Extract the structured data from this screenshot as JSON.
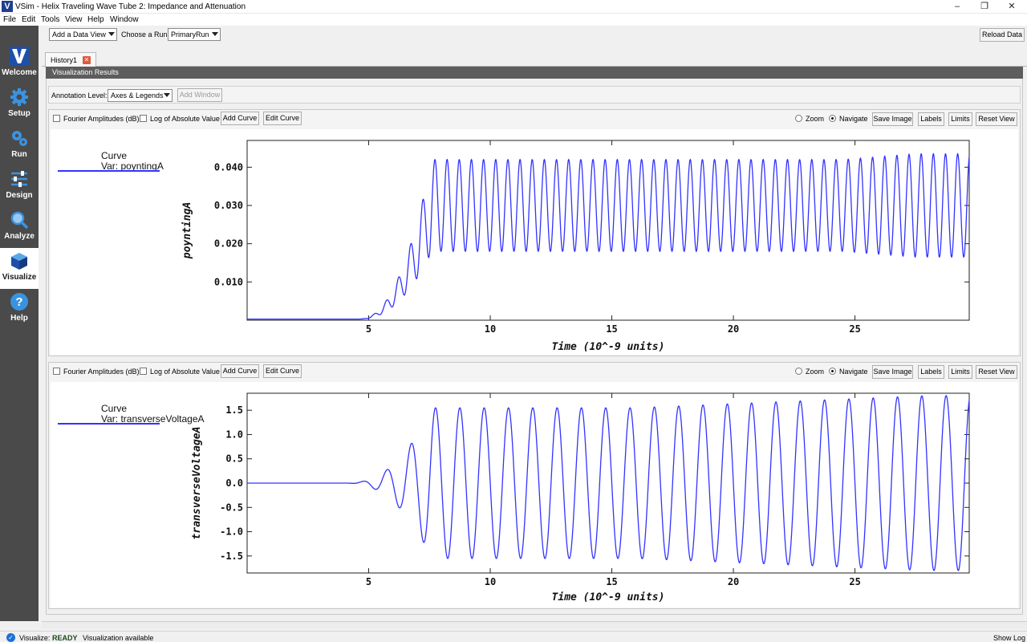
{
  "window": {
    "title": "VSim - Helix Traveling Wave Tube 2: Impedance and Attenuation",
    "app_icon": "V"
  },
  "menubar": {
    "items": [
      "File",
      "Edit",
      "Tools",
      "View",
      "Help",
      "Window"
    ]
  },
  "sidebar": {
    "items": [
      {
        "label": "Welcome",
        "icon": "vsim-logo-icon"
      },
      {
        "label": "Setup",
        "icon": "gear-icon"
      },
      {
        "label": "Run",
        "icon": "gears-icon"
      },
      {
        "label": "Design",
        "icon": "sliders-icon"
      },
      {
        "label": "Analyze",
        "icon": "magnifier-icon"
      },
      {
        "label": "Visualize",
        "icon": "cube-icon",
        "active": true
      },
      {
        "label": "Help",
        "icon": "question-icon"
      }
    ]
  },
  "toolbar": {
    "add_data_view": "Add a Data View",
    "choose_run_label": "Choose a Run:",
    "choose_run_value": "PrimaryRun",
    "reload_data": "Reload Data"
  },
  "tabs": {
    "history": "History1"
  },
  "results": {
    "header": "Visualization Results",
    "annotation_label": "Annotation Level:",
    "annotation_value": "Axes & Legends",
    "add_window": "Add Window"
  },
  "plot_toolbar": {
    "fourier": "Fourier Amplitudes (dB)",
    "log_abs": "Log of Absolute Value",
    "add_curve": "Add Curve",
    "edit_curve": "Edit Curve",
    "zoom": "Zoom",
    "navigate": "Navigate",
    "save_image": "Save Image",
    "labels": "Labels",
    "limits": "Limits",
    "reset_view": "Reset View",
    "mode_selected": "Navigate"
  },
  "chart_data": [
    {
      "type": "line",
      "legend_title": "Curve",
      "legend_var": "Var: poyntingA",
      "xlabel": "Time (10^-9 units)",
      "ylabel": "poyntingA",
      "xlim": [
        0,
        29.7
      ],
      "ylim": [
        0,
        0.047
      ],
      "xticks": [
        5,
        10,
        15,
        20,
        25
      ],
      "xtick_labels": [
        "5",
        "10",
        "15",
        "20",
        "25"
      ],
      "yticks": [
        0.01,
        0.02,
        0.03,
        0.04
      ],
      "ytick_labels": [
        "0.010",
        "0.020",
        "0.030",
        "0.040"
      ],
      "series_color": "#3333ff",
      "signal": {
        "onset": 4.6,
        "period": 0.5,
        "mean": 0.03,
        "amp_growth_end": 7.6,
        "amplitude": 0.012,
        "late_amp_start": 24.5,
        "late_amplitude": 0.0135
      }
    },
    {
      "type": "line",
      "legend_title": "Curve",
      "legend_var": "Var: transverseVoltageA",
      "xlabel": "Time (10^-9 units)",
      "ylabel": "transverseVoltageA",
      "xlim": [
        0,
        29.7
      ],
      "ylim": [
        -1.85,
        1.85
      ],
      "xticks": [
        5,
        10,
        15,
        20,
        25
      ],
      "xtick_labels": [
        "5",
        "10",
        "15",
        "20",
        "25"
      ],
      "yticks": [
        1.5,
        1.0,
        0.5,
        0.0,
        -0.5,
        -1.0,
        -1.5
      ],
      "ytick_labels": [
        "1.5",
        "1.0",
        "0.5",
        "0.0",
        "-0.5",
        "-1.0",
        "-1.5"
      ],
      "series_color": "#3333ff",
      "signal": {
        "onset": 4.0,
        "period": 1.0,
        "amplitude": 1.55,
        "late_amplitude": 1.8,
        "amp_growth_end": 7.6
      }
    }
  ],
  "status": {
    "prefix": "Visualize:",
    "state": "READY",
    "message": "Visualization available",
    "show_log": "Show Log"
  }
}
